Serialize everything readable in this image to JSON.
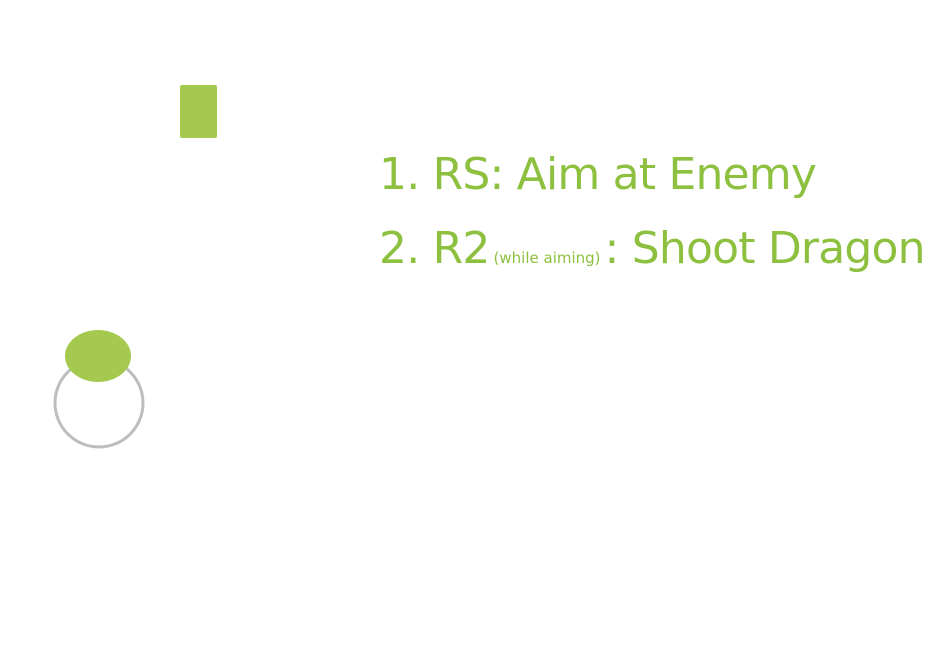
{
  "colors": {
    "accent": "#A4C94E",
    "text": "#8DC03F",
    "stick_ring": "#BDBDBD",
    "background": "#FFFFFF"
  },
  "icons": {
    "trigger": "r2-trigger-icon",
    "stick": "right-stick-icon"
  },
  "instructions": {
    "step1": "1. RS: Aim at Enemy",
    "step2_main": "2. R2",
    "step2_note": "(while aiming)",
    "step2_action": ": Shoot Dragon"
  }
}
